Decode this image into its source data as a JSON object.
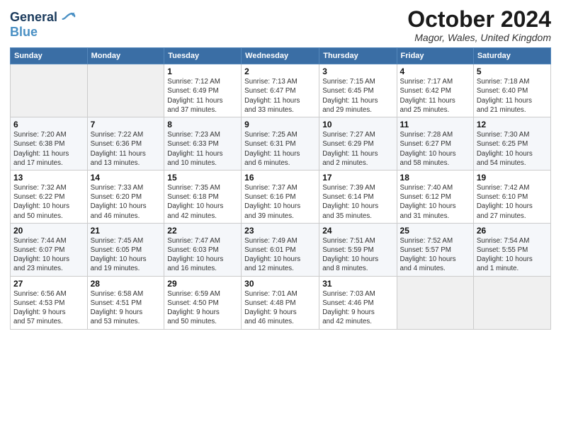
{
  "logo": {
    "line1": "General",
    "line2": "Blue"
  },
  "title": "October 2024",
  "subtitle": "Magor, Wales, United Kingdom",
  "days_of_week": [
    "Sunday",
    "Monday",
    "Tuesday",
    "Wednesday",
    "Thursday",
    "Friday",
    "Saturday"
  ],
  "weeks": [
    [
      {
        "day": "",
        "info": ""
      },
      {
        "day": "",
        "info": ""
      },
      {
        "day": "1",
        "info": "Sunrise: 7:12 AM\nSunset: 6:49 PM\nDaylight: 11 hours\nand 37 minutes."
      },
      {
        "day": "2",
        "info": "Sunrise: 7:13 AM\nSunset: 6:47 PM\nDaylight: 11 hours\nand 33 minutes."
      },
      {
        "day": "3",
        "info": "Sunrise: 7:15 AM\nSunset: 6:45 PM\nDaylight: 11 hours\nand 29 minutes."
      },
      {
        "day": "4",
        "info": "Sunrise: 7:17 AM\nSunset: 6:42 PM\nDaylight: 11 hours\nand 25 minutes."
      },
      {
        "day": "5",
        "info": "Sunrise: 7:18 AM\nSunset: 6:40 PM\nDaylight: 11 hours\nand 21 minutes."
      }
    ],
    [
      {
        "day": "6",
        "info": "Sunrise: 7:20 AM\nSunset: 6:38 PM\nDaylight: 11 hours\nand 17 minutes."
      },
      {
        "day": "7",
        "info": "Sunrise: 7:22 AM\nSunset: 6:36 PM\nDaylight: 11 hours\nand 13 minutes."
      },
      {
        "day": "8",
        "info": "Sunrise: 7:23 AM\nSunset: 6:33 PM\nDaylight: 11 hours\nand 10 minutes."
      },
      {
        "day": "9",
        "info": "Sunrise: 7:25 AM\nSunset: 6:31 PM\nDaylight: 11 hours\nand 6 minutes."
      },
      {
        "day": "10",
        "info": "Sunrise: 7:27 AM\nSunset: 6:29 PM\nDaylight: 11 hours\nand 2 minutes."
      },
      {
        "day": "11",
        "info": "Sunrise: 7:28 AM\nSunset: 6:27 PM\nDaylight: 10 hours\nand 58 minutes."
      },
      {
        "day": "12",
        "info": "Sunrise: 7:30 AM\nSunset: 6:25 PM\nDaylight: 10 hours\nand 54 minutes."
      }
    ],
    [
      {
        "day": "13",
        "info": "Sunrise: 7:32 AM\nSunset: 6:22 PM\nDaylight: 10 hours\nand 50 minutes."
      },
      {
        "day": "14",
        "info": "Sunrise: 7:33 AM\nSunset: 6:20 PM\nDaylight: 10 hours\nand 46 minutes."
      },
      {
        "day": "15",
        "info": "Sunrise: 7:35 AM\nSunset: 6:18 PM\nDaylight: 10 hours\nand 42 minutes."
      },
      {
        "day": "16",
        "info": "Sunrise: 7:37 AM\nSunset: 6:16 PM\nDaylight: 10 hours\nand 39 minutes."
      },
      {
        "day": "17",
        "info": "Sunrise: 7:39 AM\nSunset: 6:14 PM\nDaylight: 10 hours\nand 35 minutes."
      },
      {
        "day": "18",
        "info": "Sunrise: 7:40 AM\nSunset: 6:12 PM\nDaylight: 10 hours\nand 31 minutes."
      },
      {
        "day": "19",
        "info": "Sunrise: 7:42 AM\nSunset: 6:10 PM\nDaylight: 10 hours\nand 27 minutes."
      }
    ],
    [
      {
        "day": "20",
        "info": "Sunrise: 7:44 AM\nSunset: 6:07 PM\nDaylight: 10 hours\nand 23 minutes."
      },
      {
        "day": "21",
        "info": "Sunrise: 7:45 AM\nSunset: 6:05 PM\nDaylight: 10 hours\nand 19 minutes."
      },
      {
        "day": "22",
        "info": "Sunrise: 7:47 AM\nSunset: 6:03 PM\nDaylight: 10 hours\nand 16 minutes."
      },
      {
        "day": "23",
        "info": "Sunrise: 7:49 AM\nSunset: 6:01 PM\nDaylight: 10 hours\nand 12 minutes."
      },
      {
        "day": "24",
        "info": "Sunrise: 7:51 AM\nSunset: 5:59 PM\nDaylight: 10 hours\nand 8 minutes."
      },
      {
        "day": "25",
        "info": "Sunrise: 7:52 AM\nSunset: 5:57 PM\nDaylight: 10 hours\nand 4 minutes."
      },
      {
        "day": "26",
        "info": "Sunrise: 7:54 AM\nSunset: 5:55 PM\nDaylight: 10 hours\nand 1 minute."
      }
    ],
    [
      {
        "day": "27",
        "info": "Sunrise: 6:56 AM\nSunset: 4:53 PM\nDaylight: 9 hours\nand 57 minutes."
      },
      {
        "day": "28",
        "info": "Sunrise: 6:58 AM\nSunset: 4:51 PM\nDaylight: 9 hours\nand 53 minutes."
      },
      {
        "day": "29",
        "info": "Sunrise: 6:59 AM\nSunset: 4:50 PM\nDaylight: 9 hours\nand 50 minutes."
      },
      {
        "day": "30",
        "info": "Sunrise: 7:01 AM\nSunset: 4:48 PM\nDaylight: 9 hours\nand 46 minutes."
      },
      {
        "day": "31",
        "info": "Sunrise: 7:03 AM\nSunset: 4:46 PM\nDaylight: 9 hours\nand 42 minutes."
      },
      {
        "day": "",
        "info": ""
      },
      {
        "day": "",
        "info": ""
      }
    ]
  ]
}
